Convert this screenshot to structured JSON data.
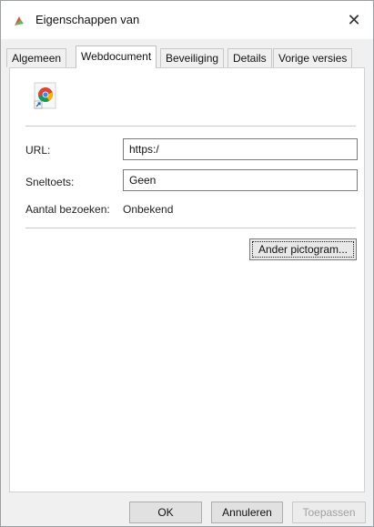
{
  "window": {
    "title": "Eigenschappen van",
    "close_glyph": "✕"
  },
  "tabs": [
    {
      "label": "Algemeen",
      "active": false
    },
    {
      "label": "Webdocument",
      "active": true
    },
    {
      "label": "Beveiliging",
      "active": false
    },
    {
      "label": "Details",
      "active": false
    },
    {
      "label": "Vorige versies",
      "active": false
    }
  ],
  "webdocument": {
    "icon": "chrome-shortcut-icon",
    "url_label": "URL:",
    "url_value": "https:/",
    "shortcut_label": "Sneltoets:",
    "shortcut_value": "Geen",
    "visits_label": "Aantal bezoeken:",
    "visits_value": "Onbekend",
    "change_icon_button": "Ander pictogram..."
  },
  "footer": {
    "ok_label": "OK",
    "cancel_label": "Annuleren",
    "apply_label": "Toepassen"
  }
}
